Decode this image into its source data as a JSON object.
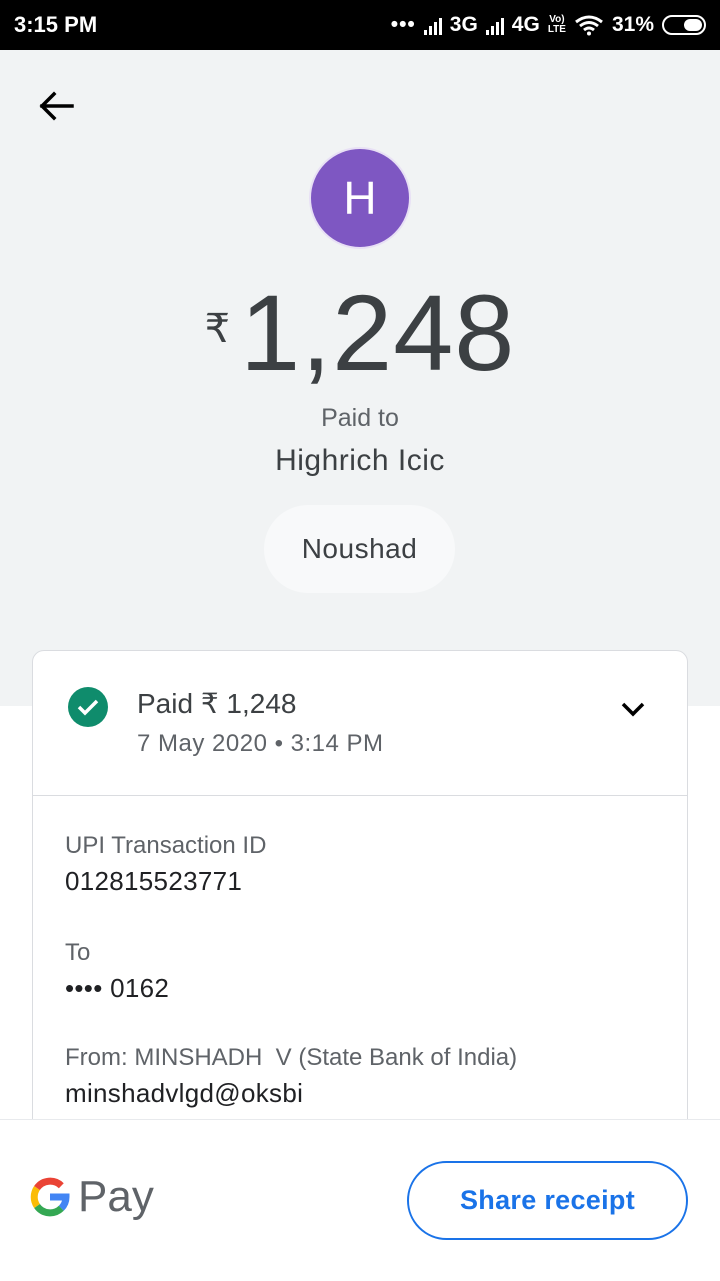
{
  "status_bar": {
    "time": "3:15 PM",
    "network_3g": "3G",
    "network_4g": "4G",
    "volte_top": "Vo)",
    "volte_bottom": "LTE",
    "battery": "31%"
  },
  "header": {
    "avatar_letter": "H",
    "currency_symbol": "₹",
    "amount": "1,248",
    "paid_to_label": "Paid to",
    "payee_name": "Highrich Icic",
    "note": "Noushad"
  },
  "transaction": {
    "status": "Paid ₹ 1,248",
    "datetime": "7 May 2020 • 3:14 PM",
    "upi_label": "UPI Transaction ID",
    "upi_id": "012815523771",
    "to_label": "To",
    "to_account": "•••• 0162",
    "from_label": "From: MINSHADH  V (State Bank of India)",
    "from_vpa": "minshadvlgd@oksbi"
  },
  "footer": {
    "brand_text": "Pay",
    "share_label": "Share receipt"
  },
  "colors": {
    "accent": "#1a73e8",
    "avatar": "#7e57c2",
    "success": "#0f8c6c",
    "hero_bg": "#f1f3f4"
  },
  "icons": [
    "back-arrow-icon",
    "check-circle-icon",
    "chevron-down-icon",
    "google-g-icon",
    "wifi-icon",
    "battery-icon"
  ]
}
